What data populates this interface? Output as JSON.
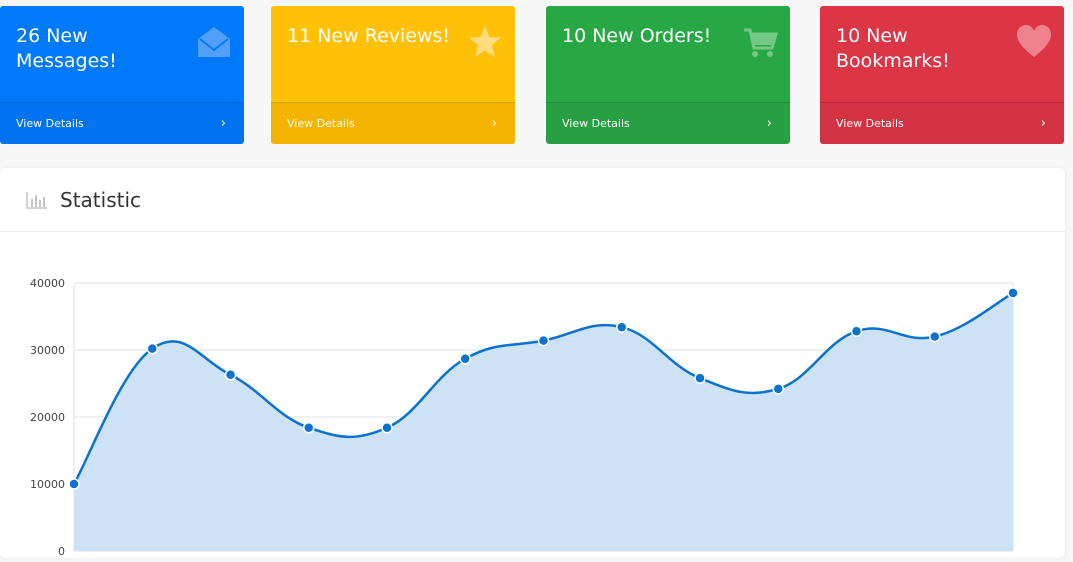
{
  "cards": [
    {
      "title": "26 New Messages!",
      "link": "View Details",
      "arrow": "›",
      "icon": "envelope-open-icon",
      "color": "#0079fa"
    },
    {
      "title": "11 New Reviews!",
      "link": "View Details",
      "arrow": "›",
      "icon": "star-icon",
      "color": "#ffc107"
    },
    {
      "title": "10 New Orders!",
      "link": "View Details",
      "arrow": "›",
      "icon": "cart-icon",
      "color": "#28a745"
    },
    {
      "title": "10 New Bookmarks!",
      "link": "View Details",
      "arrow": "›",
      "icon": "heart-icon",
      "color": "#dc3545"
    }
  ],
  "panel": {
    "title": "Statistic",
    "icon": "bar-chart-icon"
  },
  "chart_data": {
    "type": "area",
    "title": "",
    "xlabel": "",
    "ylabel": "",
    "ylim": [
      0,
      40000
    ],
    "yticks": [
      0,
      10000,
      20000,
      30000,
      40000
    ],
    "grid": true,
    "values": [
      10000,
      30200,
      26300,
      18400,
      18400,
      28700,
      31400,
      33400,
      25800,
      24200,
      32800,
      32000,
      38500
    ],
    "color": "#0b72cf",
    "fill": "#cde2f5"
  }
}
